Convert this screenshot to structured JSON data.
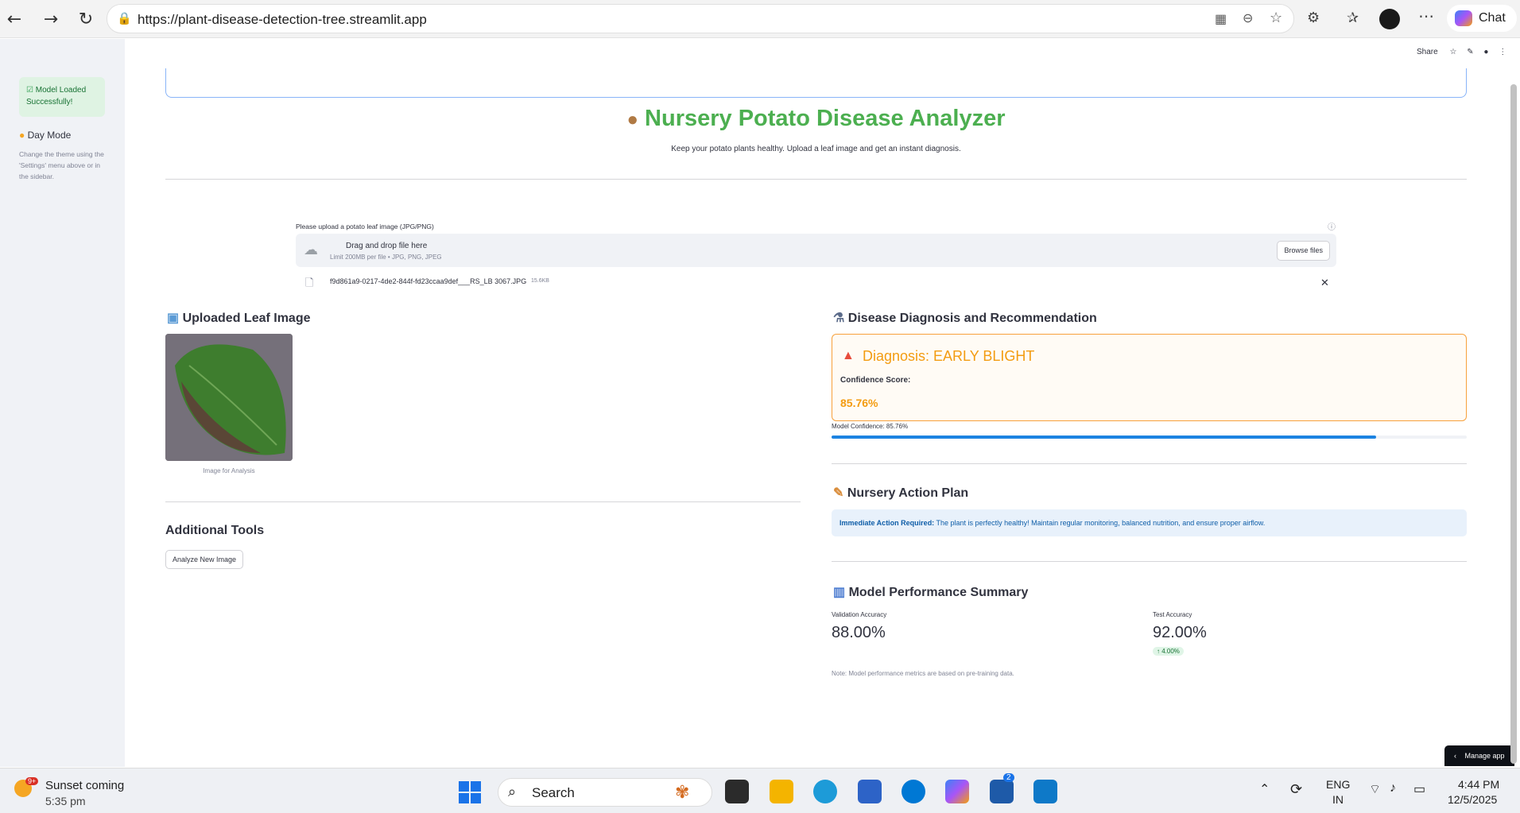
{
  "browser": {
    "url": "https://plant-disease-detection-tree.streamlit.app",
    "copilot_label": "Chat"
  },
  "sidebar": {
    "model_status": "Model Loaded Successfully!",
    "day_mode": "Day Mode",
    "theme_note": "Change the theme using the 'Settings' menu above or in the sidebar."
  },
  "header": {
    "share": "Share",
    "title": "Nursery Potato Disease Analyzer",
    "subtitle": "Keep your potato plants healthy. Upload a leaf image and get an instant diagnosis."
  },
  "uploader": {
    "label": "Please upload a potato leaf image (JPG/PNG)",
    "drag_text": "Drag and drop file here",
    "limit_text": "Limit 200MB per file • JPG, PNG, JPEG",
    "browse_label": "Browse files",
    "file_name": "f9d861a9-0217-4de2-844f-fd23ccaa9def___RS_LB 3067.JPG",
    "file_size": "15.6KB"
  },
  "uploaded": {
    "heading": "Uploaded Leaf Image",
    "caption": "Image for Analysis"
  },
  "diagnosis": {
    "heading": "Disease Diagnosis and Recommendation",
    "title": "Diagnosis: EARLY BLIGHT",
    "confidence_label": "Confidence Score:",
    "confidence_value": "85.76%",
    "model_confidence": "Model Confidence: 85.76%",
    "progress": 0.8576
  },
  "action_plan": {
    "heading": "Nursery Action Plan",
    "label": "Immediate Action Required:",
    "text": "The plant is perfectly healthy! Maintain regular monitoring, balanced nutrition, and ensure proper airflow."
  },
  "tools": {
    "heading": "Additional Tools",
    "analyze_button": "Analyze New Image"
  },
  "performance": {
    "heading": "Model Performance Summary",
    "validation_label": "Validation Accuracy",
    "validation_value": "88.00%",
    "test_label": "Test Accuracy",
    "test_value": "92.00%",
    "delta": "4.00%",
    "note": "Note: Model performance metrics are based on pre-training data."
  },
  "manage_app": "Manage app",
  "taskbar": {
    "weather_badge": "9+",
    "weather_title": "Sunset coming",
    "weather_time": "5:35 pm",
    "search": "Search",
    "lang": "ENG",
    "region": "IN",
    "time": "4:44 PM",
    "date": "12/5/2025",
    "teams_badge": "2"
  }
}
